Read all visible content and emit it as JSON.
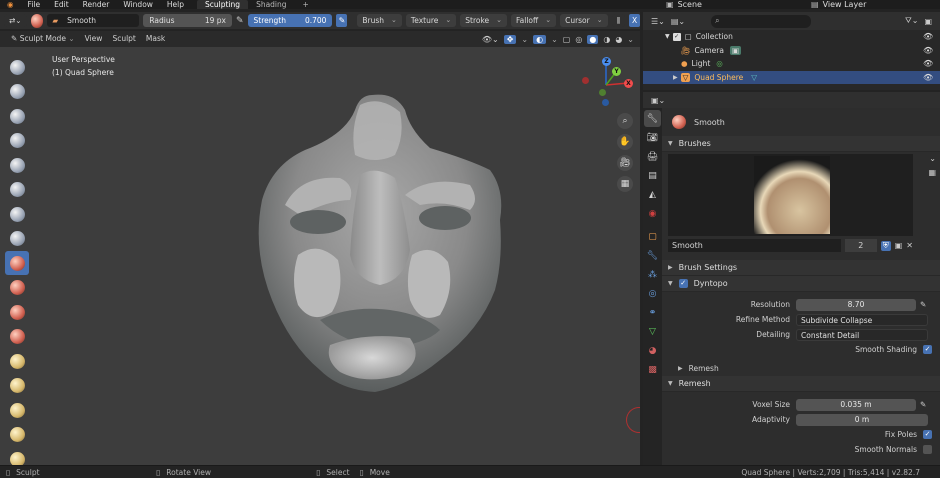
{
  "topbar": {
    "menus": [
      "File",
      "Edit",
      "Render",
      "Window",
      "Help"
    ],
    "workspaces": [
      "Sculpting",
      "Shading"
    ],
    "active_workspace": "Sculpting",
    "add_tab": "+",
    "scene": "Scene",
    "view_layer": "View Layer"
  },
  "toolheader": {
    "brush_name": "Smooth",
    "radius_label": "Radius",
    "radius_value": "19 px",
    "strength_label": "Strength",
    "strength_value": "0.700",
    "menus": [
      "Brush",
      "Texture",
      "Stroke",
      "Falloff",
      "Cursor"
    ],
    "x_label": "X"
  },
  "viewheader": {
    "mode": "Sculpt Mode",
    "menus": [
      "View",
      "Sculpt",
      "Mask"
    ]
  },
  "viewport": {
    "perspective": "User Perspective",
    "object": "(1) Quad Sphere",
    "gizmo": {
      "z": "Z",
      "x": "X",
      "y": "Y"
    }
  },
  "outliner": {
    "items": [
      {
        "label": "Collection",
        "depth": 1,
        "selected": false
      },
      {
        "label": "Camera",
        "depth": 2,
        "selected": false
      },
      {
        "label": "Light",
        "depth": 2,
        "selected": false
      },
      {
        "label": "Quad Sphere",
        "depth": 2,
        "selected": true
      }
    ]
  },
  "properties": {
    "brush_header": "Smooth",
    "brushes_section": "Brushes",
    "brush_slot": {
      "name": "Smooth",
      "users": "2"
    },
    "brush_settings_section": "Brush Settings",
    "dyntopo_section": "Dyntopo",
    "resolution_label": "Resolution",
    "resolution_value": "8.70",
    "refine_label": "Refine Method",
    "refine_value": "Subdivide Collapse",
    "detailing_label": "Detailing",
    "detailing_value": "Constant Detail",
    "smooth_shading_label": "Smooth Shading",
    "smooth_shading": true,
    "dyntopo_remesh_section": "Remesh",
    "remesh_section": "Remesh",
    "voxel_label": "Voxel Size",
    "voxel_value": "0.035 m",
    "adaptivity_label": "Adaptivity",
    "adaptivity_value": "0 m",
    "fix_poles_label": "Fix Poles",
    "fix_poles": true,
    "smooth_normals_label": "Smooth Normals",
    "smooth_normals": false
  },
  "statusbar": {
    "left": "Sculpt",
    "rotate": "Rotate View",
    "select": "Select",
    "move": "Move",
    "stats": "Quad Sphere | Verts:2,709 | Tris:5,414 | v2.82.7"
  },
  "colors": {
    "accent": "#4772b3",
    "selection": "#334d80",
    "viewport_bg": "#3d3d3d"
  }
}
